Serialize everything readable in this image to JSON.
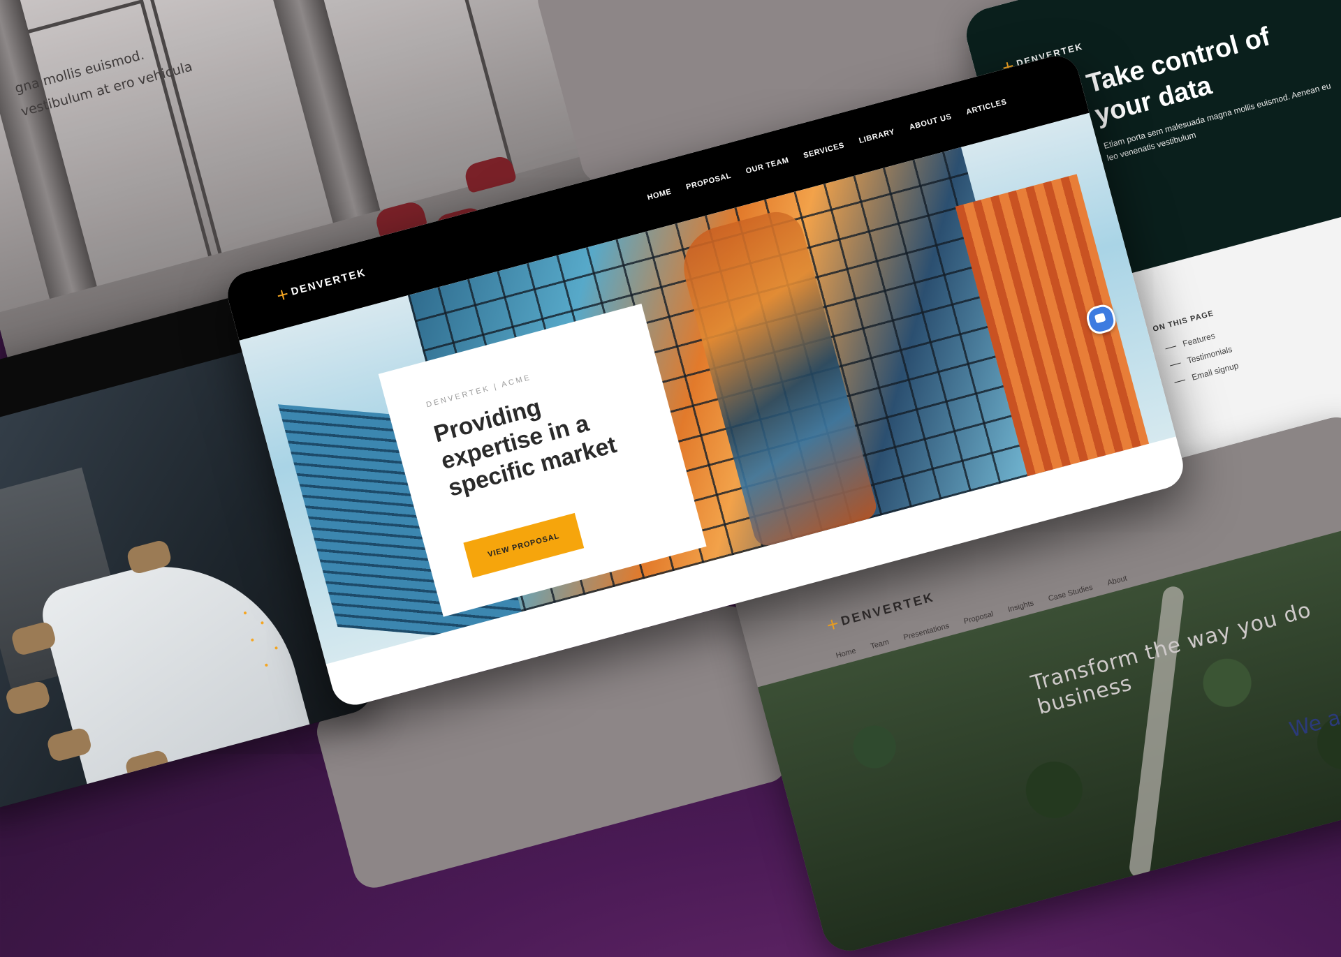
{
  "office_card": {
    "caption_line1": "gna mollis euismod.",
    "caption_line2": "vestibulum at ero vehicula"
  },
  "data_card": {
    "brand": "DENVERTEK",
    "title": "Take control of your data",
    "subtitle": "Etiam porta sem malesuada magna mollis euismod. Aenean eu leo venenatis vestibulum",
    "on_this_page": "ON THIS PAGE",
    "links": [
      "Features",
      "Testimonials",
      "Email signup"
    ]
  },
  "main_card": {
    "brand": "DENVERTEK",
    "nav": [
      "HOME",
      "PROPOSAL",
      "OUR TEAM",
      "SERVICES",
      "LIBRARY",
      "ABOUT US",
      "ARTICLES"
    ],
    "eyebrow": "DENVERTEK | ACME",
    "headline": "Providing expertise in a specific market",
    "cta": "VIEW PROPOSAL"
  },
  "forest_card": {
    "brand": "DENVERTEK",
    "nav": [
      "Home",
      "Team",
      "Presentations",
      "Proposal",
      "Insights",
      "Case Studies",
      "About"
    ],
    "headline": "Transform the way you do business",
    "side_text": "We are"
  },
  "colors": {
    "accent": "#f6a50c",
    "background": "#4a1a55",
    "dark_card": "#0a1f1c",
    "chat_button": "#3d7be0"
  }
}
